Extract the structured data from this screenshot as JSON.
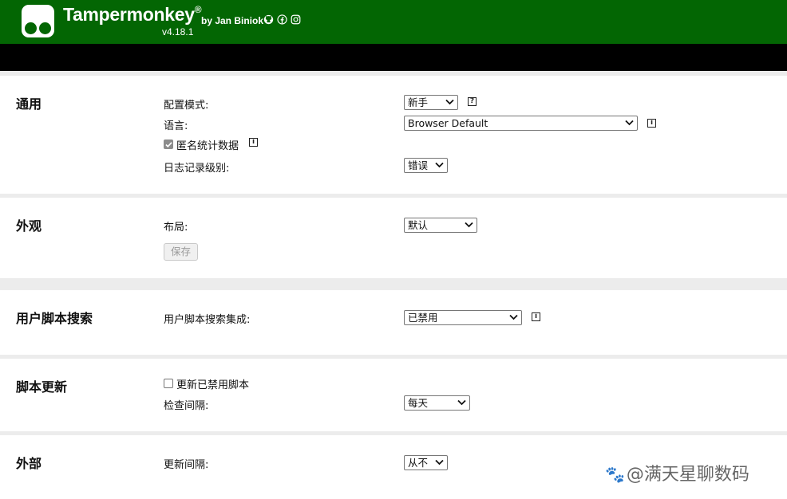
{
  "header": {
    "title": "Tampermonkey",
    "registered": "®",
    "byline": "by Jan Biniok",
    "version": "v4.18.1",
    "social_icons": [
      "github-icon",
      "facebook-icon",
      "instagram-icon"
    ],
    "bg_color": "#036603"
  },
  "sections": {
    "general": {
      "title": "通用",
      "config_mode_label": "配置模式:",
      "config_mode_value": "新手",
      "language_label": "语言:",
      "language_value": "Browser Default",
      "anon_stats_label": "匿名统计数据",
      "anon_stats_checked": true,
      "log_level_label": "日志记录级别:",
      "log_level_value": "错误",
      "help_icon": "?",
      "info_icon": "i"
    },
    "appearance": {
      "title": "外观",
      "layout_label": "布局:",
      "layout_value": "默认",
      "save_label": "保存"
    },
    "script_search": {
      "title": "用户脚本搜索",
      "integration_label": "用户脚本搜索集成:",
      "integration_value": "已禁用"
    },
    "script_update": {
      "title": "脚本更新",
      "update_disabled_label": "更新已禁用脚本",
      "update_disabled_checked": false,
      "check_interval_label": "检查间隔:",
      "check_interval_value": "每天"
    },
    "external": {
      "title": "外部",
      "update_interval_label": "更新间隔:",
      "update_interval_value": "从不"
    }
  },
  "watermark": "@满天星聊数码"
}
